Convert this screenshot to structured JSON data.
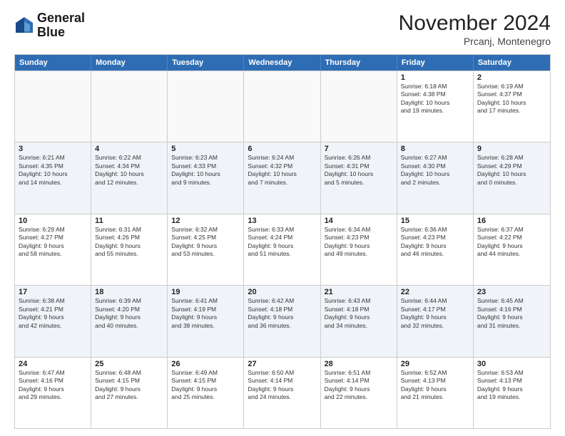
{
  "header": {
    "logo_line1": "General",
    "logo_line2": "Blue",
    "title": "November 2024",
    "subtitle": "Prcanj, Montenegro"
  },
  "days_of_week": [
    "Sunday",
    "Monday",
    "Tuesday",
    "Wednesday",
    "Thursday",
    "Friday",
    "Saturday"
  ],
  "rows": [
    [
      {
        "day": "",
        "text": "",
        "empty": true
      },
      {
        "day": "",
        "text": "",
        "empty": true
      },
      {
        "day": "",
        "text": "",
        "empty": true
      },
      {
        "day": "",
        "text": "",
        "empty": true
      },
      {
        "day": "",
        "text": "",
        "empty": true
      },
      {
        "day": "1",
        "text": "Sunrise: 6:18 AM\nSunset: 4:38 PM\nDaylight: 10 hours\nand 19 minutes."
      },
      {
        "day": "2",
        "text": "Sunrise: 6:19 AM\nSunset: 4:37 PM\nDaylight: 10 hours\nand 17 minutes."
      }
    ],
    [
      {
        "day": "3",
        "text": "Sunrise: 6:21 AM\nSunset: 4:35 PM\nDaylight: 10 hours\nand 14 minutes."
      },
      {
        "day": "4",
        "text": "Sunrise: 6:22 AM\nSunset: 4:34 PM\nDaylight: 10 hours\nand 12 minutes."
      },
      {
        "day": "5",
        "text": "Sunrise: 6:23 AM\nSunset: 4:33 PM\nDaylight: 10 hours\nand 9 minutes."
      },
      {
        "day": "6",
        "text": "Sunrise: 6:24 AM\nSunset: 4:32 PM\nDaylight: 10 hours\nand 7 minutes."
      },
      {
        "day": "7",
        "text": "Sunrise: 6:26 AM\nSunset: 4:31 PM\nDaylight: 10 hours\nand 5 minutes."
      },
      {
        "day": "8",
        "text": "Sunrise: 6:27 AM\nSunset: 4:30 PM\nDaylight: 10 hours\nand 2 minutes."
      },
      {
        "day": "9",
        "text": "Sunrise: 6:28 AM\nSunset: 4:29 PM\nDaylight: 10 hours\nand 0 minutes."
      }
    ],
    [
      {
        "day": "10",
        "text": "Sunrise: 6:29 AM\nSunset: 4:27 PM\nDaylight: 9 hours\nand 58 minutes."
      },
      {
        "day": "11",
        "text": "Sunrise: 6:31 AM\nSunset: 4:26 PM\nDaylight: 9 hours\nand 55 minutes."
      },
      {
        "day": "12",
        "text": "Sunrise: 6:32 AM\nSunset: 4:25 PM\nDaylight: 9 hours\nand 53 minutes."
      },
      {
        "day": "13",
        "text": "Sunrise: 6:33 AM\nSunset: 4:24 PM\nDaylight: 9 hours\nand 51 minutes."
      },
      {
        "day": "14",
        "text": "Sunrise: 6:34 AM\nSunset: 4:23 PM\nDaylight: 9 hours\nand 49 minutes."
      },
      {
        "day": "15",
        "text": "Sunrise: 6:36 AM\nSunset: 4:23 PM\nDaylight: 9 hours\nand 46 minutes."
      },
      {
        "day": "16",
        "text": "Sunrise: 6:37 AM\nSunset: 4:22 PM\nDaylight: 9 hours\nand 44 minutes."
      }
    ],
    [
      {
        "day": "17",
        "text": "Sunrise: 6:38 AM\nSunset: 4:21 PM\nDaylight: 9 hours\nand 42 minutes."
      },
      {
        "day": "18",
        "text": "Sunrise: 6:39 AM\nSunset: 4:20 PM\nDaylight: 9 hours\nand 40 minutes."
      },
      {
        "day": "19",
        "text": "Sunrise: 6:41 AM\nSunset: 4:19 PM\nDaylight: 9 hours\nand 38 minutes."
      },
      {
        "day": "20",
        "text": "Sunrise: 6:42 AM\nSunset: 4:18 PM\nDaylight: 9 hours\nand 36 minutes."
      },
      {
        "day": "21",
        "text": "Sunrise: 6:43 AM\nSunset: 4:18 PM\nDaylight: 9 hours\nand 34 minutes."
      },
      {
        "day": "22",
        "text": "Sunrise: 6:44 AM\nSunset: 4:17 PM\nDaylight: 9 hours\nand 32 minutes."
      },
      {
        "day": "23",
        "text": "Sunrise: 6:45 AM\nSunset: 4:16 PM\nDaylight: 9 hours\nand 31 minutes."
      }
    ],
    [
      {
        "day": "24",
        "text": "Sunrise: 6:47 AM\nSunset: 4:16 PM\nDaylight: 9 hours\nand 29 minutes."
      },
      {
        "day": "25",
        "text": "Sunrise: 6:48 AM\nSunset: 4:15 PM\nDaylight: 9 hours\nand 27 minutes."
      },
      {
        "day": "26",
        "text": "Sunrise: 6:49 AM\nSunset: 4:15 PM\nDaylight: 9 hours\nand 25 minutes."
      },
      {
        "day": "27",
        "text": "Sunrise: 6:50 AM\nSunset: 4:14 PM\nDaylight: 9 hours\nand 24 minutes."
      },
      {
        "day": "28",
        "text": "Sunrise: 6:51 AM\nSunset: 4:14 PM\nDaylight: 9 hours\nand 22 minutes."
      },
      {
        "day": "29",
        "text": "Sunrise: 6:52 AM\nSunset: 4:13 PM\nDaylight: 9 hours\nand 21 minutes."
      },
      {
        "day": "30",
        "text": "Sunrise: 6:53 AM\nSunset: 4:13 PM\nDaylight: 9 hours\nand 19 minutes."
      }
    ]
  ]
}
